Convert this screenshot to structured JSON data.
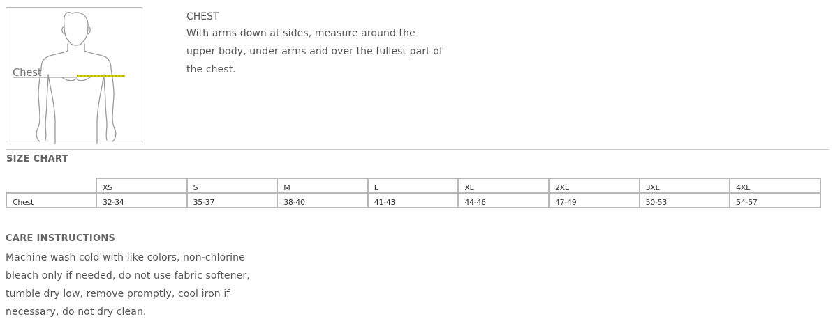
{
  "figure": {
    "label": "Chest",
    "icon": "male-torso-outline-icon",
    "measure_line_color": "#d4d400"
  },
  "measurement": {
    "title": "CHEST",
    "description_lines": [
      "With arms down at sides, measure around the",
      "upper body, under arms and over the fullest part of",
      "the chest."
    ]
  },
  "size_chart": {
    "heading": "SIZE CHART",
    "sizes": [
      "XS",
      "S",
      "M",
      "L",
      "XL",
      "2XL",
      "3XL",
      "4XL"
    ],
    "rows": [
      {
        "label": "Chest",
        "values": [
          "32-34",
          "35-37",
          "38-40",
          "41-43",
          "44-46",
          "47-49",
          "50-53",
          "54-57"
        ]
      }
    ]
  },
  "care": {
    "heading": "CARE INSTRUCTIONS",
    "lines": [
      "Machine wash cold with like colors, non-chlorine",
      "bleach only if needed, do not use fabric softener,",
      "tumble dry low, remove promptly, cool iron if",
      "necessary, do not dry clean."
    ]
  },
  "colors": {
    "text": "#555555",
    "border": "#b8b8b8",
    "divider": "#c8c8c8"
  }
}
